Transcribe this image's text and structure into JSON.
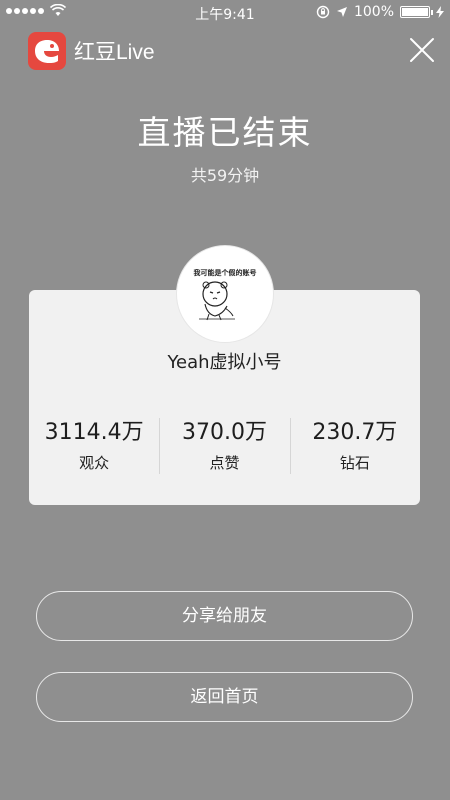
{
  "status_bar": {
    "time": "上午9:41",
    "battery": "100%",
    "battery_level": 1.0,
    "icons": [
      "signal-dots-icon",
      "wifi-icon",
      "lock-rotation-icon",
      "location-arrow-icon",
      "battery-icon",
      "charging-bolt-icon"
    ]
  },
  "app": {
    "name": "红豆Live",
    "logo_icon": "app-logo-icon",
    "brand_color": "#e5483f",
    "close_icon": "close-icon"
  },
  "live_end": {
    "title": "直播已结束",
    "duration": "共59分钟"
  },
  "profile": {
    "avatar_caption": "我可能是个假的账号",
    "username": "Yeah虚拟小号"
  },
  "stats": [
    {
      "value": "3114.4万",
      "label": "观众"
    },
    {
      "value": "370.0万",
      "label": "点赞"
    },
    {
      "value": "230.7万",
      "label": "钻石"
    }
  ],
  "actions": {
    "share_label": "分享给朋友",
    "home_label": "返回首页"
  }
}
